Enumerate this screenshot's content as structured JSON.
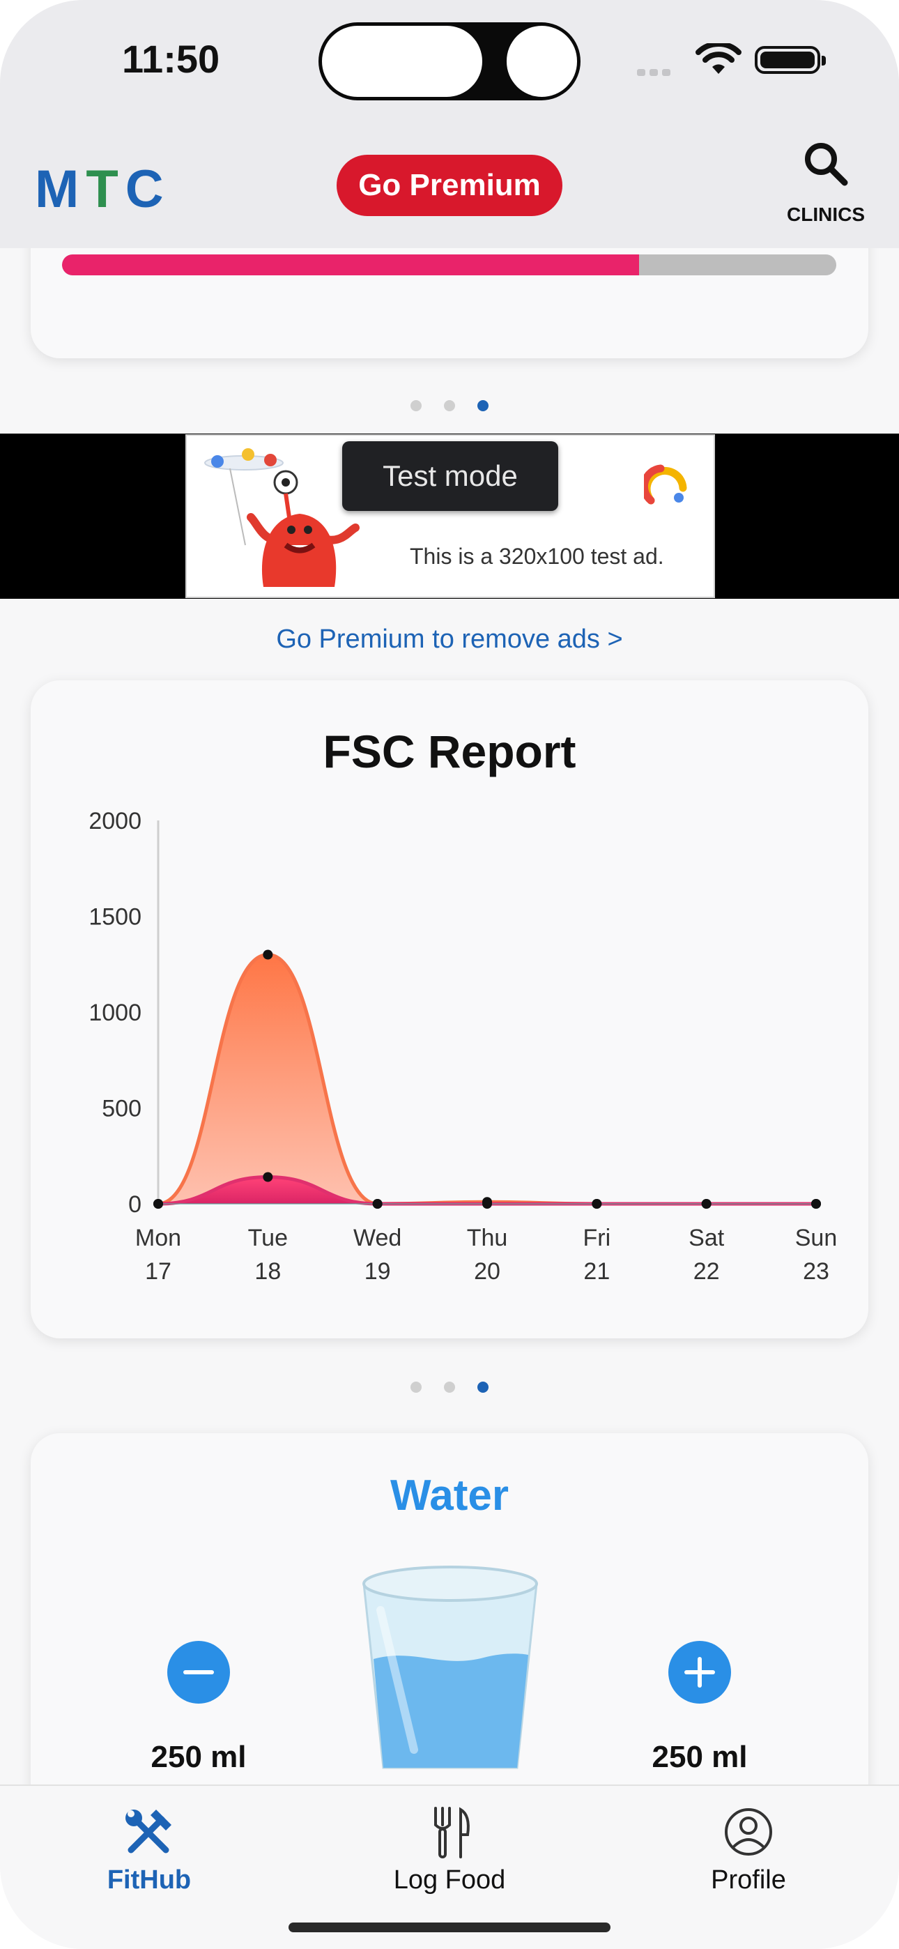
{
  "status_bar": {
    "time": "11:50"
  },
  "header": {
    "logo": {
      "m": "M",
      "t": "T",
      "c": "C"
    },
    "premium_button": "Go Premium",
    "clinics_label": "CLINICS"
  },
  "top_card": {
    "progress_fraction": 0.745,
    "progress_color": "#e9236a"
  },
  "carousel_dots": {
    "count": 3,
    "active_index": 2
  },
  "ad": {
    "tooltip": "Test mode",
    "text": "This is a 320x100 test ad."
  },
  "premium_link": "Go Premium to remove ads >",
  "fsc_report": {
    "title": "FSC Report"
  },
  "chart_data": {
    "type": "area",
    "title": "FSC Report",
    "categories": [
      "Mon 17",
      "Tue 18",
      "Wed 19",
      "Thu 20",
      "Fri 21",
      "Sat 22",
      "Sun 23"
    ],
    "x_tick_labels": [
      {
        "day": "Mon",
        "date": "17"
      },
      {
        "day": "Tue",
        "date": "18"
      },
      {
        "day": "Wed",
        "date": "19"
      },
      {
        "day": "Thu",
        "date": "20"
      },
      {
        "day": "Fri",
        "date": "21"
      },
      {
        "day": "Sat",
        "date": "22"
      },
      {
        "day": "Sun",
        "date": "23"
      }
    ],
    "y_ticks": [
      "2000",
      "1500",
      "1000",
      "500",
      "0"
    ],
    "ylim": [
      0,
      2000
    ],
    "series": [
      {
        "values": [
          0,
          1300,
          0,
          10,
          0,
          0,
          0
        ],
        "color": "#f7744a"
      },
      {
        "values": [
          0,
          140,
          0,
          0,
          0,
          0,
          0
        ],
        "color": "#e0306e"
      }
    ],
    "grid": false,
    "legend": "none"
  },
  "water": {
    "title": "Water",
    "minus_amount": "250 ml",
    "plus_amount": "250 ml"
  },
  "tabbar": {
    "fithub": "FitHub",
    "logfood": "Log Food",
    "profile": "Profile"
  }
}
